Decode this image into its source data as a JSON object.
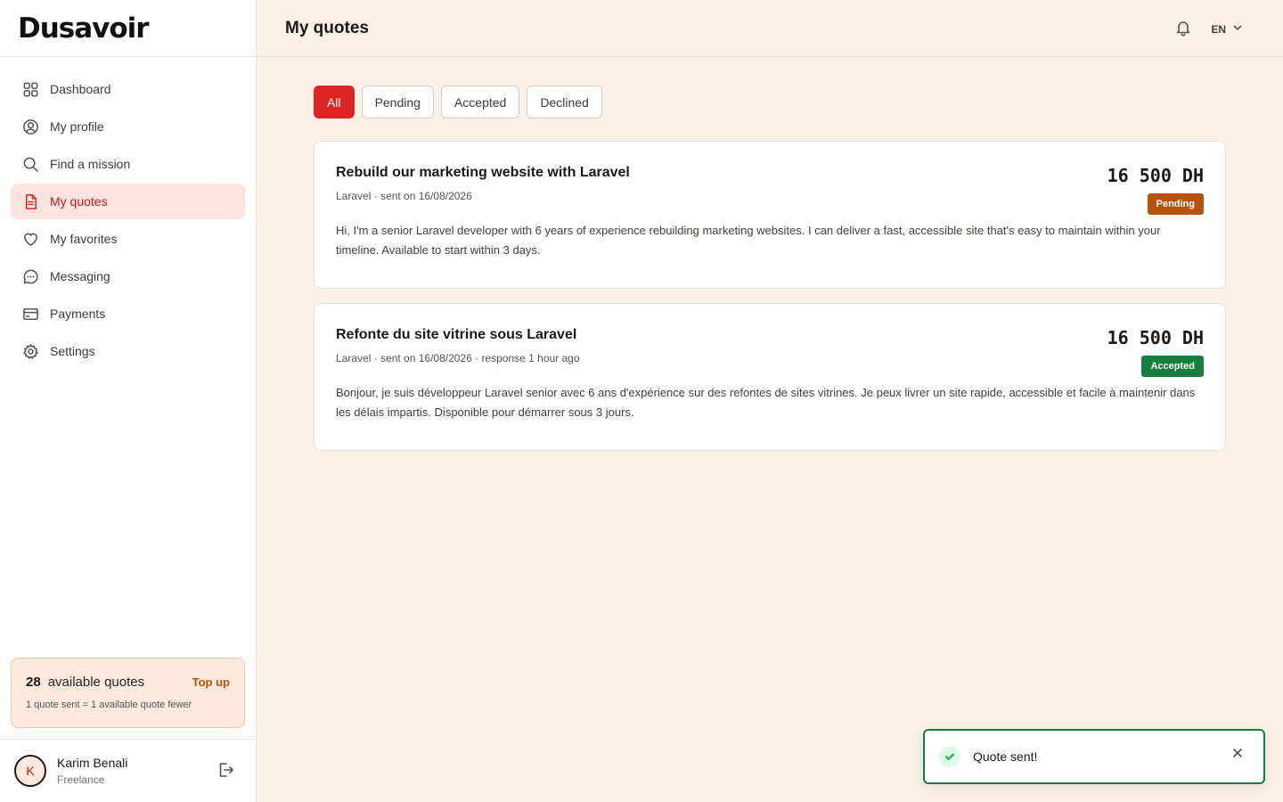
{
  "brand": {
    "logo": "Dusavoir"
  },
  "sidebar": {
    "items": [
      {
        "label": "Dashboard",
        "icon": "grid-icon"
      },
      {
        "label": "My profile",
        "icon": "user-circle-icon"
      },
      {
        "label": "Find a mission",
        "icon": "search-icon"
      },
      {
        "label": "My quotes",
        "icon": "document-icon",
        "active": true
      },
      {
        "label": "My favorites",
        "icon": "heart-icon"
      },
      {
        "label": "Messaging",
        "icon": "chat-icon"
      },
      {
        "label": "Payments",
        "icon": "credit-card-icon"
      },
      {
        "label": "Settings",
        "icon": "gear-icon"
      }
    ]
  },
  "quota": {
    "count": "28",
    "label": "available quotes",
    "link": "Top up",
    "note": "1 quote sent = 1 available quote fewer"
  },
  "user": {
    "initial": "K",
    "name": "Karim Benali",
    "role": "Freelance"
  },
  "header": {
    "title": "My quotes",
    "lang": "EN"
  },
  "filters": [
    "All",
    "Pending",
    "Accepted",
    "Declined"
  ],
  "quotes": [
    {
      "title": "Rebuild our marketing website with Laravel",
      "meta": "Laravel · sent on 16/08/2026",
      "price": "16 500 DH",
      "status": "Pending",
      "status_color": "#b45309",
      "body": "Hi, I'm a senior Laravel developer with 6 years of experience rebuilding marketing websites. I can deliver a fast, accessible site that's easy to maintain within your timeline. Available to start within 3 days."
    },
    {
      "title": "Refonte du site vitrine sous Laravel",
      "meta": "Laravel · sent on 16/08/2026 · response 1 hour ago",
      "price": "16 500 DH",
      "status": "Accepted",
      "status_color": "#15803d",
      "body": "Bonjour, je suis développeur Laravel senior avec 6 ans d'expérience sur des refontes de sites vitrines. Je peux livrer un site rapide, accessible et facile à maintenir dans les délais impartis. Disponible pour démarrer sous 3 jours."
    }
  ],
  "toast": {
    "message": "Quote sent!"
  },
  "colors": {
    "accent": "#dc2626",
    "background": "#faf1e6",
    "success": "#15803d",
    "pending": "#b45309"
  }
}
